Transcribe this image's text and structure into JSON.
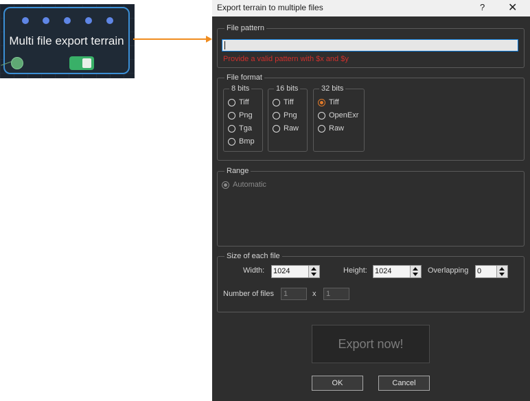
{
  "node": {
    "title": "Multi file export terrain",
    "accent_color": "#3b8fd6",
    "arrow_color": "#f08c1e"
  },
  "dialog": {
    "title": "Export terrain to multiple files",
    "help_label": "?",
    "close_label": "✕",
    "file_pattern": {
      "legend": "File pattern",
      "value": "",
      "error": "Provide a valid pattern with $x and $y"
    },
    "file_format": {
      "legend": "File format",
      "groups": [
        {
          "legend": "8 bits",
          "options": [
            "Tiff",
            "Png",
            "Tga",
            "Bmp"
          ]
        },
        {
          "legend": "16 bits",
          "options": [
            "Tiff",
            "Png",
            "Raw"
          ]
        },
        {
          "legend": "32 bits",
          "options": [
            "Tiff",
            "OpenExr",
            "Raw"
          ]
        }
      ],
      "selected": "32 bits / Tiff"
    },
    "range": {
      "legend": "Range",
      "option": "Automatic"
    },
    "size": {
      "legend": "Size of each file",
      "width_label": "Width:",
      "width_value": "1024",
      "height_label": "Height:",
      "height_value": "1024",
      "overlap_label": "Overlapping",
      "overlap_value": "0",
      "num_files_label": "Number of files",
      "num_x": "1",
      "times": "x",
      "num_y": "1"
    },
    "export_label": "Export now!",
    "ok_label": "OK",
    "cancel_label": "Cancel"
  }
}
